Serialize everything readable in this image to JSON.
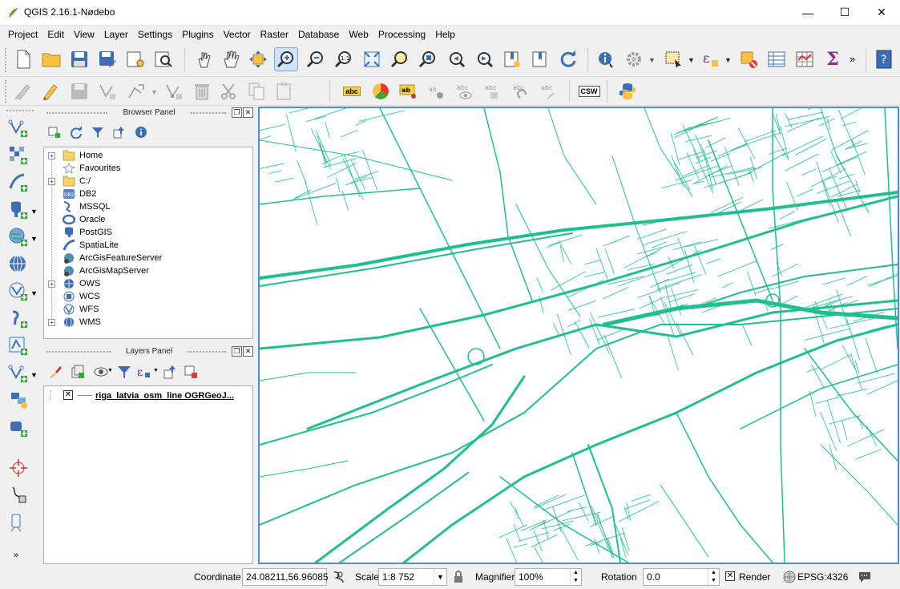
{
  "window": {
    "title": "QGIS 2.16.1-Nødebo",
    "minimize": "—",
    "maximize": "☐",
    "close": "✕"
  },
  "menu": [
    "Project",
    "Edit",
    "View",
    "Layer",
    "Settings",
    "Plugins",
    "Vector",
    "Raster",
    "Database",
    "Web",
    "Processing",
    "Help"
  ],
  "toolbar": {
    "more": "»",
    "label_abc": "abc",
    "label_csw": "CSW",
    "label_sum": "Σ"
  },
  "browser_panel": {
    "title": "Browser Panel",
    "items": [
      {
        "label": "Home",
        "icon": "folder-icon",
        "expandable": true
      },
      {
        "label": "Favourites",
        "icon": "star-icon",
        "expandable": false
      },
      {
        "label": "C:/",
        "icon": "folder-icon",
        "expandable": true
      },
      {
        "label": "DB2",
        "icon": "db2-icon",
        "expandable": false
      },
      {
        "label": "MSSQL",
        "icon": "mssql-icon",
        "expandable": false
      },
      {
        "label": "Oracle",
        "icon": "oracle-icon",
        "expandable": false
      },
      {
        "label": "PostGIS",
        "icon": "postgis-icon",
        "expandable": false
      },
      {
        "label": "SpatiaLite",
        "icon": "spatialite-icon",
        "expandable": false
      },
      {
        "label": "ArcGisFeatureServer",
        "icon": "arcgis-feature-icon",
        "expandable": false
      },
      {
        "label": "ArcGisMapServer",
        "icon": "arcgis-map-icon",
        "expandable": false
      },
      {
        "label": "OWS",
        "icon": "ows-icon",
        "expandable": true
      },
      {
        "label": "WCS",
        "icon": "wcs-icon",
        "expandable": false
      },
      {
        "label": "WFS",
        "icon": "wfs-icon",
        "expandable": false
      },
      {
        "label": "WMS",
        "icon": "wms-icon",
        "expandable": true
      }
    ]
  },
  "layers_panel": {
    "title": "Layers Panel",
    "layers": [
      {
        "name": "riga_latvia_osm_line OGRGeoJ...",
        "visible": true,
        "color": "#1fbf8f"
      }
    ]
  },
  "map": {
    "line_color": "#1fbf8f",
    "border_color": "#4a90d9"
  },
  "status": {
    "coordinate_label": "Coordinate",
    "coordinate_value": "24.08211,56.96085",
    "scale_label": "Scale",
    "scale_value": "1:8 752",
    "magnifier_label": "Magnifier",
    "magnifier_value": "100%",
    "rotation_label": "Rotation",
    "rotation_value": "0.0",
    "render_label": "Render",
    "render_checked": true,
    "crs_label": "EPSG:4326"
  }
}
